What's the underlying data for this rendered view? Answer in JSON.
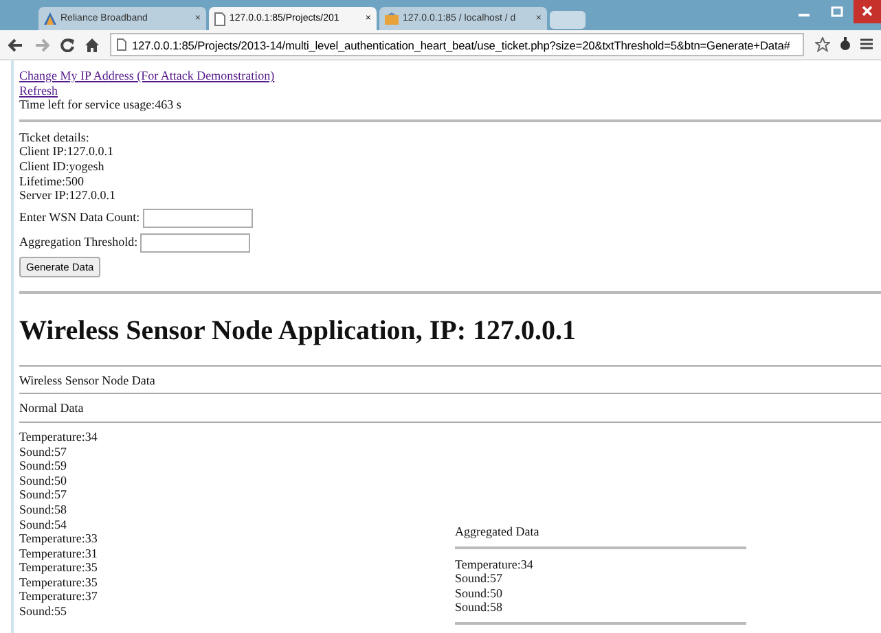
{
  "browser": {
    "tabs": [
      {
        "title": "Reliance Broadband",
        "selected": false
      },
      {
        "title": "127.0.0.1:85/Projects/201",
        "selected": true
      },
      {
        "title": "127.0.0.1:85 / localhost / d",
        "selected": false
      }
    ],
    "close_glyph": "×",
    "address": "127.0.0.1:85/Projects/2013-14/multi_level_authentication_heart_beat/use_ticket.php?size=20&txtThreshold=5&btn=Generate+Data#"
  },
  "links": [
    "Change My IP Address (For Attack Demonstration)",
    "Refresh"
  ],
  "time_left": "Time left for service usage:463 s",
  "ticket": [
    "Ticket details:",
    "Client IP:127.0.0.1",
    "Client ID:yogesh",
    "Lifetime:500",
    "Server IP:127.0.0.1"
  ],
  "fields": [
    {
      "label": "Enter WSN Data Count:"
    },
    {
      "label": "Aggregation Threshold:"
    }
  ],
  "generate_button": "Generate Data",
  "heading": "Wireless Sensor Node Application, IP: 127.0.0.1",
  "section_title": "Wireless Sensor Node Data",
  "normal_title": "Normal Data",
  "normal_data": [
    "Temperature:34",
    "Sound:57",
    "Sound:59",
    "Sound:50",
    "Sound:57",
    "Sound:58",
    "Sound:54",
    "Temperature:33",
    "Temperature:31",
    "Temperature:35",
    "Temperature:35",
    "Temperature:37",
    "Sound:55"
  ],
  "aggregated_title": "Aggregated Data",
  "aggregated_data": [
    "Temperature:34",
    "Sound:57",
    "Sound:50",
    "Sound:58"
  ]
}
